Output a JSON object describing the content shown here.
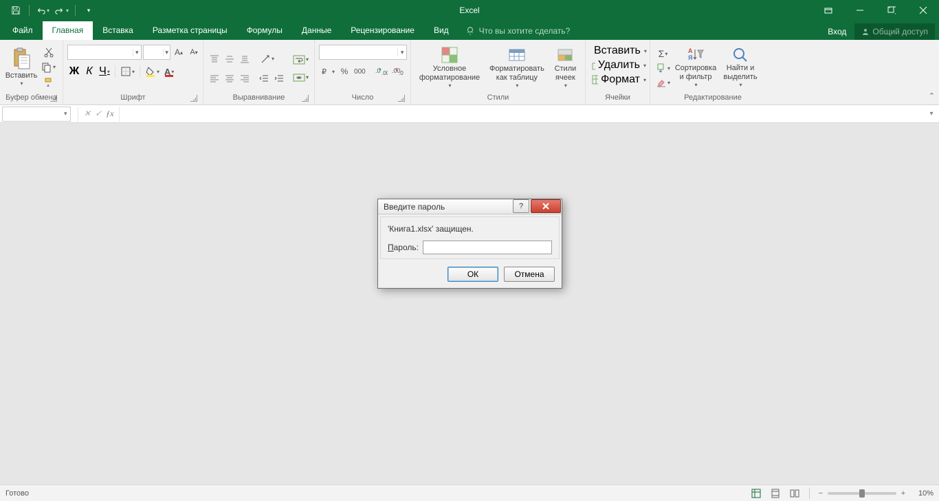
{
  "titlebar": {
    "app": "Excel"
  },
  "tabs": {
    "file": "Файл",
    "items": [
      "Главная",
      "Вставка",
      "Разметка страницы",
      "Формулы",
      "Данные",
      "Рецензирование",
      "Вид"
    ],
    "active": 0,
    "tellme": "Что вы хотите сделать?",
    "signin": "Вход",
    "share": "Общий доступ"
  },
  "ribbon": {
    "clipboard": {
      "paste": "Вставить",
      "label": "Буфер обмена"
    },
    "font": {
      "label": "Шрифт",
      "bold": "Ж",
      "italic": "К",
      "underline": "Ч"
    },
    "alignment": {
      "label": "Выравнивание"
    },
    "number": {
      "label": "Число",
      "percent": "%",
      "comma": "000"
    },
    "styles": {
      "label": "Стили",
      "cond": "Условное форматирование",
      "table": "Форматировать как таблицу",
      "cell": "Стили ячеек"
    },
    "cells": {
      "label": "Ячейки",
      "insert": "Вставить",
      "delete": "Удалить",
      "format": "Формат"
    },
    "editing": {
      "label": "Редактирование",
      "sort": "Сортировка и фильтр",
      "find": "Найти и выделить"
    }
  },
  "dialog": {
    "title": "Введите пароль",
    "message": "'Книга1.xlsx' защищен.",
    "password_label_u": "П",
    "password_label_rest": "ароль:",
    "ok": "ОК",
    "cancel": "Отмена"
  },
  "status": {
    "ready": "Готово",
    "zoom": "10%"
  }
}
